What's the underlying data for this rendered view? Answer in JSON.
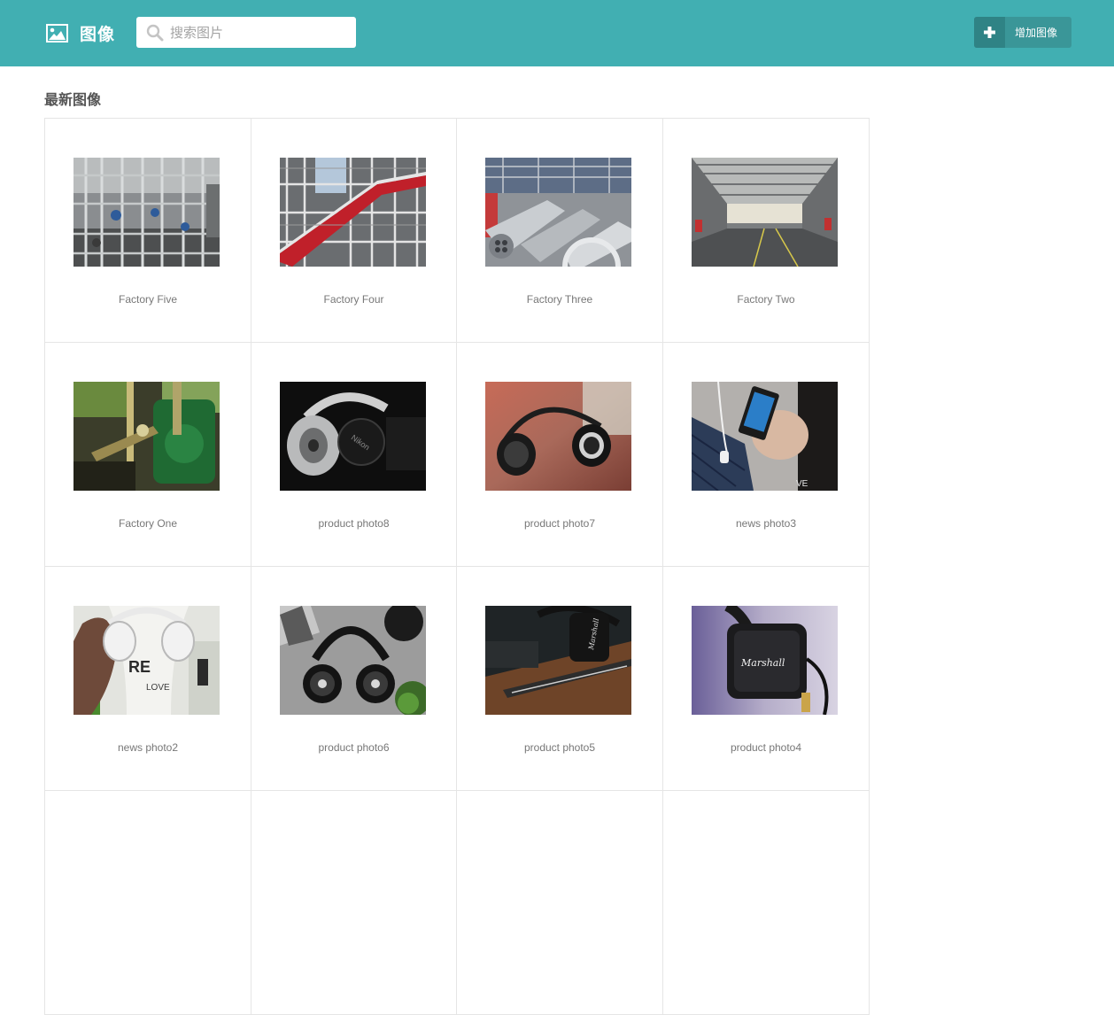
{
  "header": {
    "title": "图像",
    "title_icon": "image-icon",
    "search": {
      "placeholder": "搜索图片",
      "value": "",
      "icon": "search-icon"
    },
    "add_button": {
      "label": "增加图像",
      "icon": "plus-icon"
    }
  },
  "colors": {
    "header_bg": "#41afb2",
    "button_bg": "#3a9698",
    "button_icon_bg": "#2f8385"
  },
  "section": {
    "title": "最新图像"
  },
  "images": [
    {
      "caption": "Factory Five",
      "thumb": "factory-pipes-photo"
    },
    {
      "caption": "Factory Four",
      "thumb": "factory-scaffold-red-photo"
    },
    {
      "caption": "Factory Three",
      "thumb": "factory-tanks-photo"
    },
    {
      "caption": "Factory Two",
      "thumb": "factory-hall-photo"
    },
    {
      "caption": "Factory One",
      "thumb": "factory-machine-green-photo"
    },
    {
      "caption": "product photo8",
      "thumb": "headphones-camera-cap-photo"
    },
    {
      "caption": "product photo7",
      "thumb": "headphones-red-bg-photo"
    },
    {
      "caption": "news photo3",
      "thumb": "phone-in-hand-photo"
    },
    {
      "caption": "news photo2",
      "thumb": "woman-holding-headphones-photo"
    },
    {
      "caption": "product photo6",
      "thumb": "headphones-flatlay-photo"
    },
    {
      "caption": "product photo5",
      "thumb": "marshall-headphones-desk-photo"
    },
    {
      "caption": "product photo4",
      "thumb": "marshall-headphones-closeup-photo"
    }
  ]
}
